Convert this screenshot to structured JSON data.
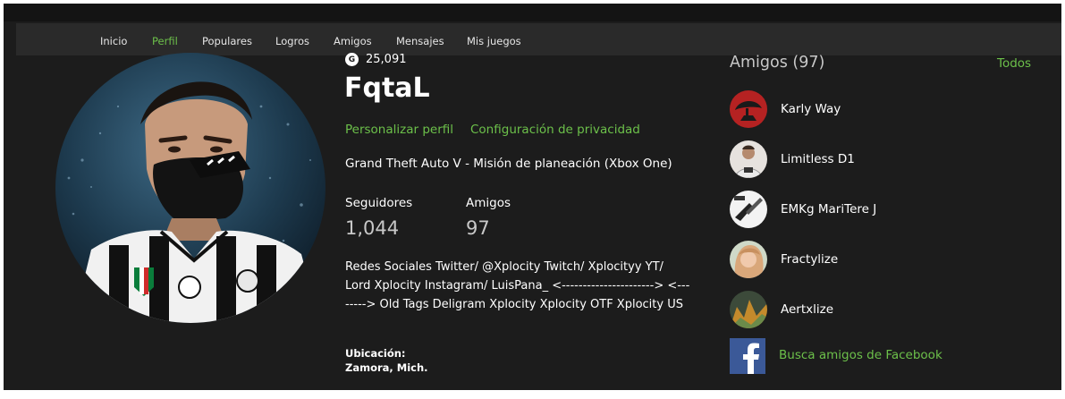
{
  "nav": {
    "items": [
      {
        "label": "Inicio"
      },
      {
        "label": "Perfil",
        "active": true
      },
      {
        "label": "Populares"
      },
      {
        "label": "Logros"
      },
      {
        "label": "Amigos"
      },
      {
        "label": "Mensajes"
      },
      {
        "label": "Mis juegos"
      }
    ]
  },
  "profile": {
    "gamerscore_icon": "G",
    "gamerscore": "25,091",
    "gamertag": "FqtaL",
    "customize_label": "Personalizar perfil",
    "privacy_label": "Configuración de privacidad",
    "presence": "Grand Theft Auto V - Misión de planeación (Xbox One)",
    "followers_label": "Seguidores",
    "followers_value": "1,044",
    "friends_label": "Amigos",
    "friends_value": "97",
    "bio": "Redes Sociales Twitter/ @Xplocity Twitch/ Xplocityy YT/ Lord Xplocity Instagram/ LuisPana_ <----------------------> <--------> Old Tags Deligram Xplocity Xplocity OTF Xplocity US",
    "location_label": "Ubicación:",
    "location_value": "Zamora, Mich."
  },
  "friends_panel": {
    "title": "Amigos (97)",
    "see_all": "Todos",
    "friends": [
      {
        "name": "Karly Way"
      },
      {
        "name": "Limitless D1"
      },
      {
        "name": "EMKg MariTere J"
      },
      {
        "name": "Fractylize"
      },
      {
        "name": "Aertxlize"
      }
    ],
    "facebook_label": "Busca amigos de Facebook"
  },
  "colors": {
    "accent": "#6cc04a",
    "background": "#1c1c1c",
    "navbar": "#2a2a2a",
    "facebook": "#3b5998"
  }
}
